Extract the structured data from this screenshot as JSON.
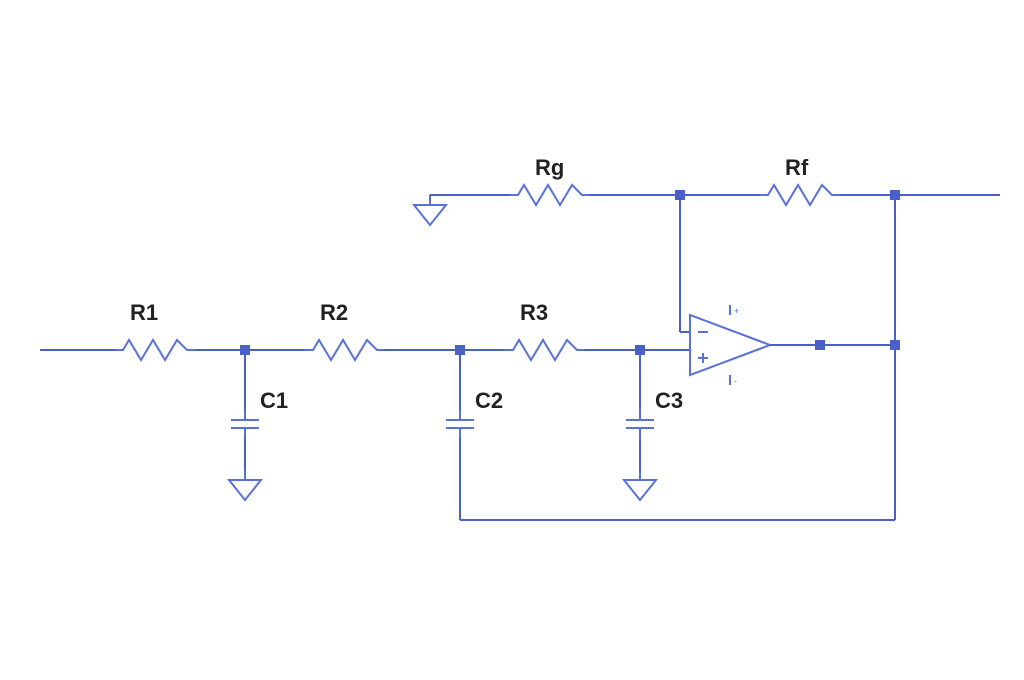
{
  "circuit": {
    "type": "active-low-pass-filter-3rd-order",
    "labels": {
      "R1": "R1",
      "R2": "R2",
      "R3": "R3",
      "Rg": "Rg",
      "Rf": "Rf",
      "C1": "C1",
      "C2": "C2",
      "C3": "C3"
    },
    "colors": {
      "wire": "#4a5fc7",
      "component": "#5a72d8",
      "label": "#222222"
    }
  }
}
